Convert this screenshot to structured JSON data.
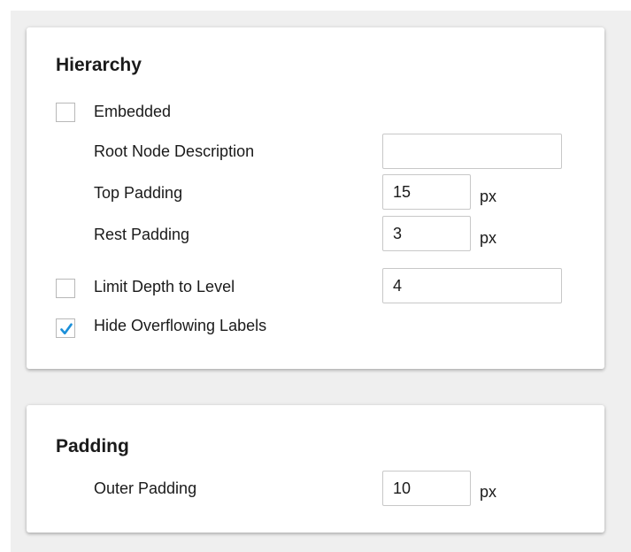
{
  "hierarchy": {
    "title": "Hierarchy",
    "embedded": {
      "label": "Embedded",
      "checked": false
    },
    "root_node_description": {
      "label": "Root Node Description",
      "value": ""
    },
    "top_padding": {
      "label": "Top Padding",
      "value": "15",
      "unit": "px"
    },
    "rest_padding": {
      "label": "Rest Padding",
      "value": "3",
      "unit": "px"
    },
    "limit_depth": {
      "label": "Limit Depth to Level",
      "checked": false,
      "value": "4"
    },
    "hide_overflowing_labels": {
      "label": "Hide Overflowing Labels",
      "checked": true
    }
  },
  "padding": {
    "title": "Padding",
    "outer_padding": {
      "label": "Outer Padding",
      "value": "10",
      "unit": "px"
    }
  },
  "colors": {
    "checkmark": "#1a8fd9",
    "panel_background": "#efefef",
    "card_background": "#ffffff"
  }
}
